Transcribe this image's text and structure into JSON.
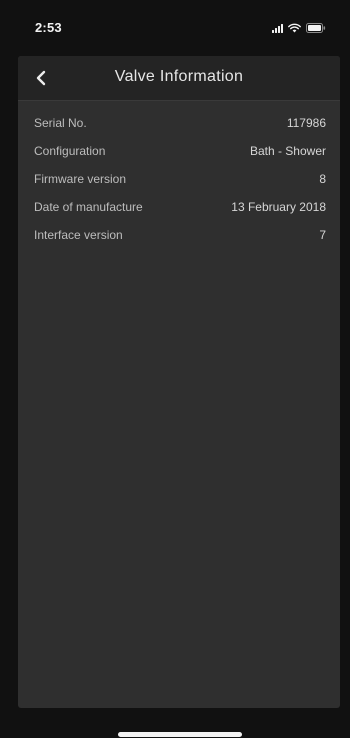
{
  "status_bar": {
    "time": "2:53",
    "icons": [
      "signal-icon",
      "wifi-icon",
      "battery-icon"
    ]
  },
  "header": {
    "back_icon": "chevron-left-icon",
    "title": "Valve Information"
  },
  "info_rows": [
    {
      "label": "Serial No.",
      "value": "117986"
    },
    {
      "label": "Configuration",
      "value": "Bath - Shower"
    },
    {
      "label": "Firmware version",
      "value": "8"
    },
    {
      "label": "Date of manufacture",
      "value": "13 February 2018"
    },
    {
      "label": "Interface version",
      "value": "7"
    }
  ],
  "colors": {
    "background": "#111111",
    "card": "#2f2f2f",
    "nav_bar": "#242424",
    "text": "#d6d6d6"
  }
}
